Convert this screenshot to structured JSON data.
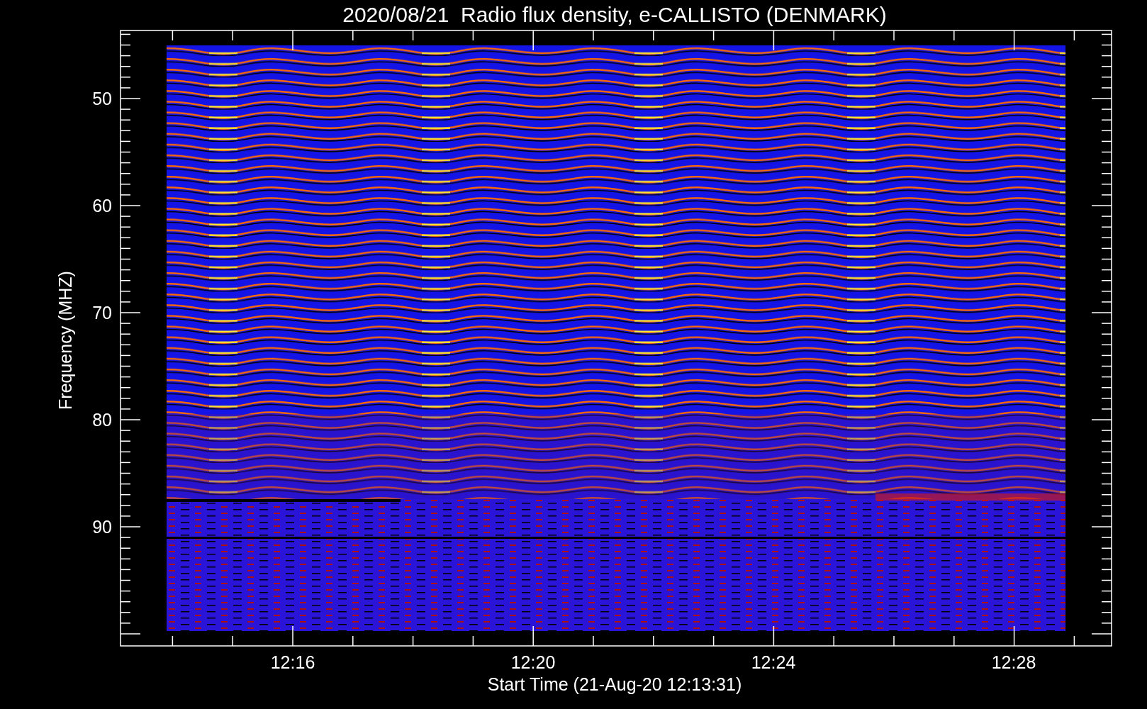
{
  "title": "2020/08/21  Radio flux density, e-CALLISTO (DENMARK)",
  "y_axis": {
    "label": "Frequency (MHZ)",
    "ticks": [
      "50",
      "60",
      "70",
      "80",
      "90"
    ]
  },
  "x_axis": {
    "label": "Start Time (21-Aug-20 12:13:31)",
    "ticks": [
      "12:16",
      "12:20",
      "12:24",
      "12:28"
    ]
  }
}
